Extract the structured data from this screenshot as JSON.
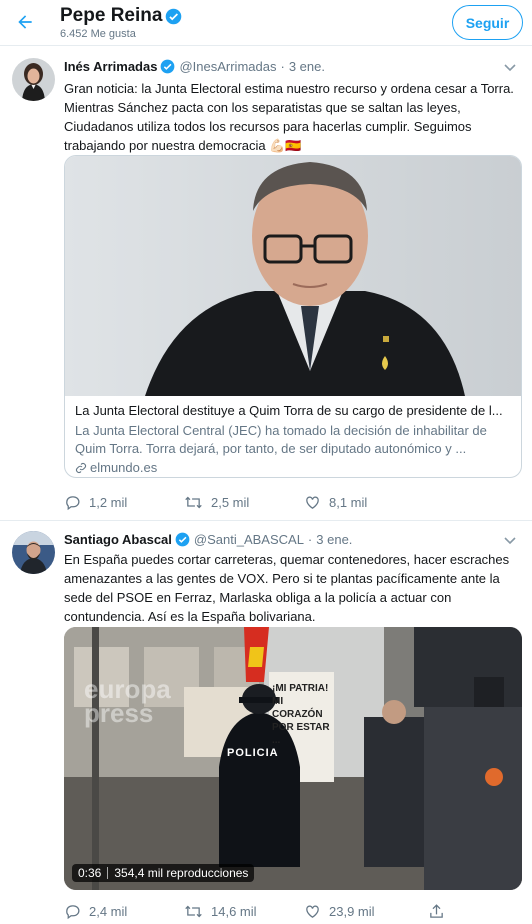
{
  "header": {
    "title": "Pepe Reina",
    "subtitle": "6.452 Me gusta",
    "follow_label": "Seguir"
  },
  "tweets": [
    {
      "name": "Inés Arrimadas",
      "handle": "@InesArrimadas",
      "separator": "·",
      "date": "3 ene.",
      "text": "Gran noticia: la Junta Electoral estima nuestro recurso y ordena cesar a Torra. Mientras Sánchez pacta con los separatistas que se saltan las leyes, Ciudadanos utiliza todos los recursos para hacerlas cumplir. Seguimos trabajando por nuestra democracia 💪🏻🇪🇸",
      "card": {
        "title": "La Junta Electoral destituye a Quim Torra de su cargo de presidente de l...",
        "description": "La Junta Electoral Central (JEC) ha tomado la decisión de inhabilitar de Quim Torra. Torra dejará, por tanto, de ser diputado autonómico y ...",
        "domain": "elmundo.es"
      },
      "stats": {
        "replies": "1,2 mil",
        "retweets": "2,5 mil",
        "likes": "8,1 mil"
      }
    },
    {
      "name": "Santiago Abascal",
      "handle": "@Santi_ABASCAL",
      "separator": "·",
      "date": "3 ene.",
      "text": "En España puedes cortar carreteras, quemar contenedores, hacer escraches amenazantes a las gentes de VOX. Pero si te plantas pacíficamente ante la sede del PSOE en Ferraz, Marlaska obliga a la policía a actuar con contundencia. Así es la España bolivariana.",
      "video": {
        "duration": "0:36",
        "views": "354,4 mil reproducciones",
        "watermark": "europa press",
        "police_label": "POLICIA",
        "sign_text": "¡MI PATRIA! MI CORAZÓN POR ESTAR ..."
      },
      "stats": {
        "replies": "2,4 mil",
        "retweets": "14,6 mil",
        "likes": "23,9 mil"
      }
    }
  ],
  "colors": {
    "accent": "#1da1f2",
    "secondary_text": "#657786",
    "border": "#e6ecf0"
  },
  "icons": {
    "back": "arrow-left-icon",
    "verified": "verified-badge-icon",
    "more": "chevron-down-icon",
    "reply": "reply-icon",
    "retweet": "retweet-icon",
    "like": "heart-icon",
    "share": "share-icon",
    "link": "link-icon"
  }
}
